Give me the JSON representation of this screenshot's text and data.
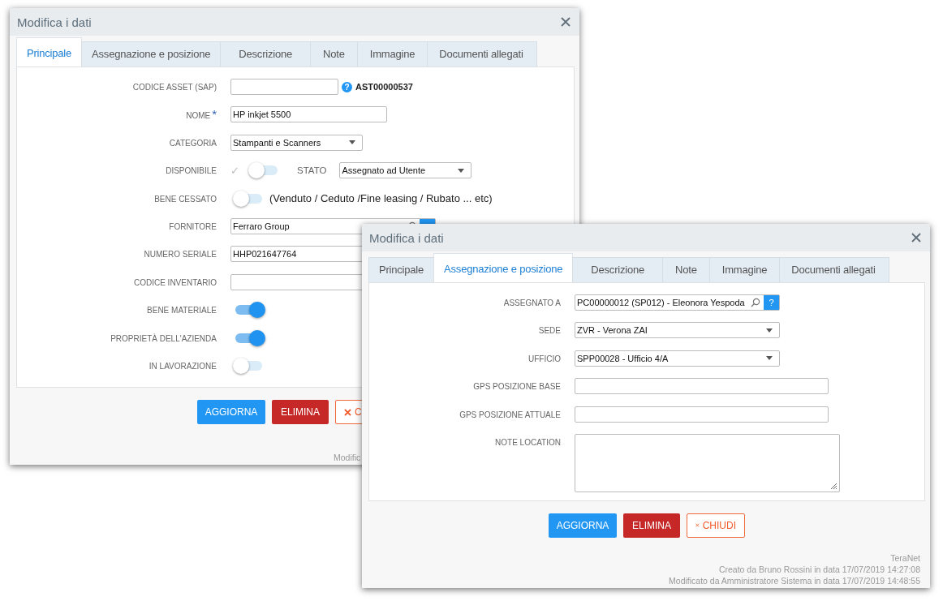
{
  "dialogs": [
    {
      "title": "Modifica i dati",
      "tabs": [
        {
          "label": "Principale",
          "selected": true
        },
        {
          "label": "Assegnazione e posizione",
          "selected": false
        },
        {
          "label": "Descrizione",
          "selected": false
        },
        {
          "label": "Note",
          "selected": false
        },
        {
          "label": "Immagine",
          "selected": false
        },
        {
          "label": "Documenti allegati",
          "selected": false
        }
      ],
      "fields": [
        {
          "kind": "input",
          "label": "CODICE ASSET (SAP)",
          "help": "?",
          "code": "AST00000537"
        },
        {
          "kind": "input",
          "label": "NOME",
          "mark": "*",
          "value": "HP inkjet 5500"
        },
        {
          "kind": "select",
          "label": "CATEGORIA",
          "value": "Stampanti e Scanners"
        },
        {
          "kind": "toggle",
          "label": "DISPONIBILE",
          "prefix": "✓",
          "on": false,
          "extra_label": "STATO",
          "extra_value": "Assegnato ad Utente"
        },
        {
          "kind": "toggle",
          "label": "BENE CESSATO",
          "on": false,
          "note": "(Venduto / Ceduto /Fine leasing / Rubato ... etc)"
        },
        {
          "kind": "lookup",
          "label": "FORNITORE",
          "value": "Ferraro Group"
        },
        {
          "kind": "input",
          "label": "NUMERO SERIALE",
          "value": "HHP021647764"
        },
        {
          "kind": "input",
          "label": "CODICE INVENTARIO"
        },
        {
          "kind": "toggle",
          "label": "BENE MATERIALE",
          "on": true
        },
        {
          "kind": "toggle",
          "label": "PROPRIETÀ DELL'AZIENDA",
          "on": true
        },
        {
          "kind": "toggle",
          "label": "IN LAVORAZIONE",
          "on": false
        }
      ],
      "buttons": [
        {
          "kind": "primary",
          "label": "AGGIORNA"
        },
        {
          "kind": "danger",
          "label": "ELIMINA"
        },
        {
          "kind": "close",
          "label": "C"
        }
      ],
      "footer": [
        "Modific"
      ]
    },
    {
      "title": "Modifica i dati",
      "tabs": [
        {
          "label": "Principale",
          "selected": false
        },
        {
          "label": "Assegnazione e posizione",
          "selected": true
        },
        {
          "label": "Descrizione",
          "selected": false
        },
        {
          "label": "Note",
          "selected": false
        },
        {
          "label": "Immagine",
          "selected": false
        },
        {
          "label": "Documenti allegati",
          "selected": false
        }
      ],
      "fields": [
        {
          "kind": "lookup",
          "label": "ASSEGNATO A",
          "value": "PC00000012 (SP012) - Eleonora Yespoda",
          "help": "?"
        },
        {
          "kind": "select",
          "label": "SEDE",
          "value": "ZVR - Verona ZAI"
        },
        {
          "kind": "select",
          "label": "UFFICIO",
          "value": "SPP00028 - Ufficio 4/A"
        },
        {
          "kind": "input",
          "label": "GPS POSIZIONE BASE"
        },
        {
          "kind": "input",
          "label": "GPS POSIZIONE ATTUALE"
        },
        {
          "kind": "textarea",
          "label": "NOTE LOCATION"
        }
      ],
      "buttons": [
        {
          "kind": "primary",
          "label": "AGGIORNA"
        },
        {
          "kind": "danger",
          "label": "ELIMINA"
        },
        {
          "kind": "close",
          "label": "CHIUDI"
        }
      ],
      "footer": [
        "TeraNet",
        "Creato da Bruno Rossini in data 17/07/2019 14:27:08",
        "Modificato da Amministratore Sistema in data 17/07/2019 14:48:55"
      ]
    }
  ]
}
